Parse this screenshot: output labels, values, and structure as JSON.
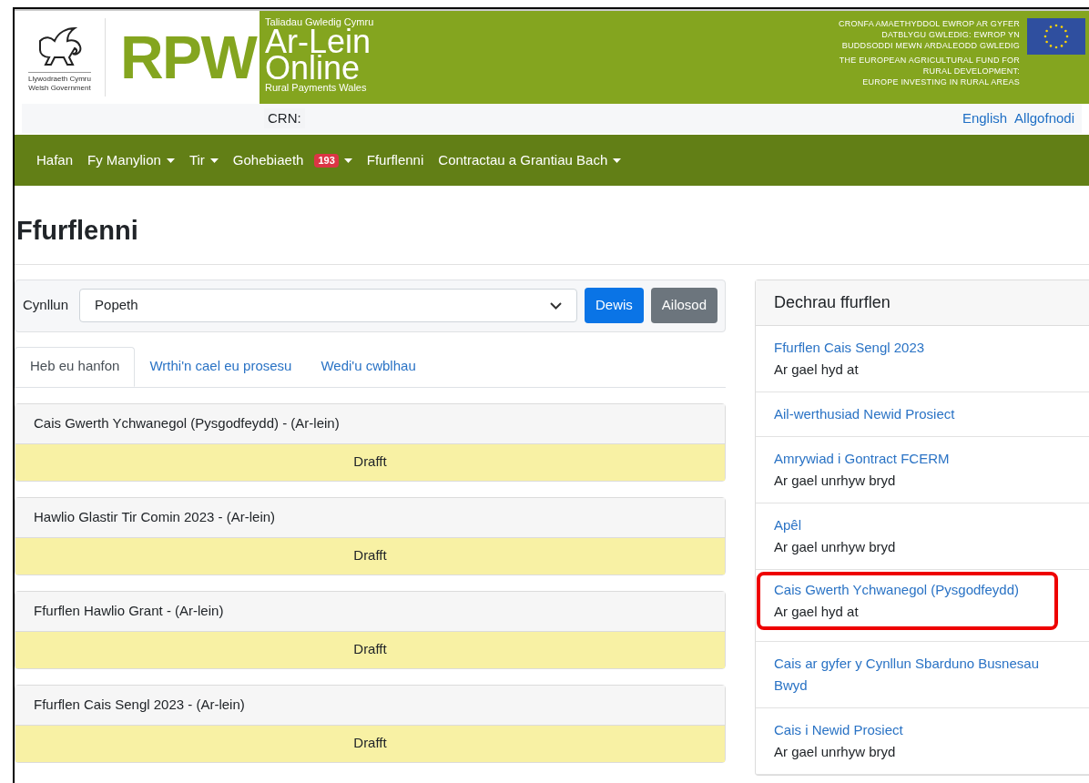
{
  "header": {
    "gov_logo": {
      "line1": "Llywodraeth Cymru",
      "line2": "Welsh Government"
    },
    "brand": "RPW",
    "tagline": "Taliadau Gwledig Cymru",
    "title_line1": "Ar-Lein",
    "title_line2": "Online",
    "subtitle": "Rural Payments Wales",
    "eu_text_cy": [
      "CRONFA AMAETHYDDOL EWROP AR GYFER",
      "DATBLYGU GWLEDIG: EWROP YN",
      "BUDDSODDI MEWN ARDALEODD GWLEDIG"
    ],
    "eu_text_en": [
      "THE EUROPEAN AGRICULTURAL FUND FOR",
      "RURAL DEVELOPMENT:",
      "EUROPE INVESTING IN RURAL AREAS"
    ]
  },
  "top_bar": {
    "crn_label": "CRN:",
    "links": [
      "English",
      "Allgofnodi"
    ]
  },
  "nav": [
    {
      "label": "Hafan",
      "dropdown": false
    },
    {
      "label": "Fy Manylion",
      "dropdown": true
    },
    {
      "label": "Tir",
      "dropdown": true
    },
    {
      "label": "Gohebiaeth",
      "dropdown": true,
      "badge": "193"
    },
    {
      "label": "Ffurflenni",
      "dropdown": false
    },
    {
      "label": "Contractau a Grantiau Bach",
      "dropdown": true
    }
  ],
  "page_title": "Ffurflenni",
  "filter": {
    "label": "Cynllun",
    "value": "Popeth",
    "buttons": [
      {
        "label": "Dewis",
        "kind": "primary"
      },
      {
        "label": "Ailosod",
        "kind": "secondary"
      }
    ]
  },
  "tabs": [
    {
      "label": "Heb eu hanfon",
      "selected": true
    },
    {
      "label": "Wrthi'n cael eu prosesu",
      "selected": false
    },
    {
      "label": "Wedi'u cwblhau",
      "selected": false
    }
  ],
  "forms": [
    {
      "title": "Cais Gwerth Ychwanegol (Pysgodfeydd) - (Ar-lein)",
      "status": "Drafft"
    },
    {
      "title": "Hawlio Glastir Tir Comin 2023 - (Ar-lein)",
      "status": "Drafft"
    },
    {
      "title": "Ffurflen Hawlio Grant - (Ar-lein)",
      "status": "Drafft"
    },
    {
      "title": "Ffurflen Cais Sengl 2023 - (Ar-lein)",
      "status": "Drafft"
    }
  ],
  "start_panel": {
    "title": "Dechrau ffurflen",
    "items": [
      {
        "link": "Ffurflen Cais Sengl 2023",
        "note": "Ar gael hyd at",
        "highlighted": false
      },
      {
        "link": "Ail-werthusiad Newid Prosiect",
        "highlighted": false
      },
      {
        "link": "Amrywiad i Gontract FCERM",
        "note": "Ar gael unrhyw bryd",
        "highlighted": false
      },
      {
        "link": "Apêl",
        "note": "Ar gael unrhyw bryd",
        "highlighted": false
      },
      {
        "link": "Cais Gwerth Ychwanegol (Pysgodfeydd)",
        "note": "Ar gael hyd at",
        "highlighted": true
      },
      {
        "link": "Cais ar gyfer y Cynllun Sbarduno Busnesau Bwyd",
        "highlighted": false
      },
      {
        "link": "Cais i Newid Prosiect",
        "note": "Ar gael unrhyw bryd",
        "highlighted": false
      }
    ]
  }
}
